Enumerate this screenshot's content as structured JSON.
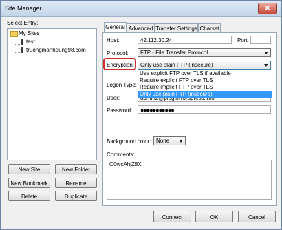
{
  "window": {
    "title": "Site Manager",
    "close_glyph": "✕"
  },
  "left": {
    "select_entry_label": "Select Entry:",
    "tree": {
      "root": "My Sites",
      "children": [
        "test",
        "truongmanhdung98.com"
      ]
    },
    "buttons": {
      "new_site": "New Site",
      "new_folder": "New Folder",
      "new_bookmark": "New Bookmark",
      "rename": "Rename",
      "delete": "Delete",
      "duplicate": "Duplicate"
    }
  },
  "tabs": [
    "General",
    "Advanced",
    "Transfer Settings",
    "Charset"
  ],
  "general": {
    "host_label": "Host:",
    "host_value": "42.112.30.24",
    "port_label": "Port:",
    "port_value": "",
    "protocol_label": "Protocol:",
    "protocol_value": "FTP - File Transfer Protocol",
    "encryption_label": "Encryption:",
    "encryption_value": "Only use plain FTP (insecure)",
    "encryption_options": [
      "Use explicit FTP over TLS if available",
      "Require explicit FTP over TLS",
      "Require implicit FTP over TLS",
      "Only use plain FTP (insecure)"
    ],
    "logon_type_label": "Logon Type:",
    "user_label": "User:",
    "user_value": "admin2@pluginwordpress.info",
    "password_label": "Password:",
    "password_value": "●●●●●●●●●●●",
    "background_color_label": "Background color:",
    "background_color_value": "None",
    "comments_label": "Comments:",
    "comments_value": "O0wcAhjZ8X"
  },
  "footer": {
    "connect": "Connect",
    "ok": "OK",
    "cancel": "Cancel"
  },
  "colors": {
    "highlight": "#3399ff",
    "annotation": "#d42a2a"
  }
}
